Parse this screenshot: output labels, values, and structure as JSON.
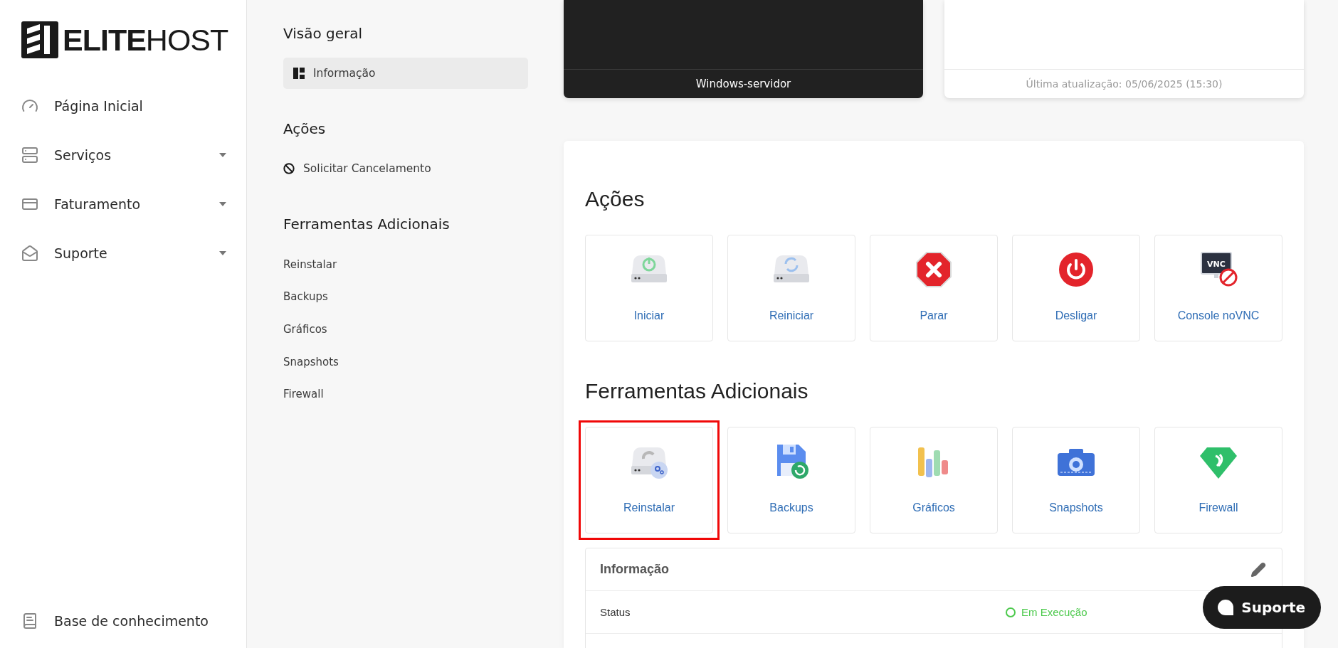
{
  "brand": {
    "bold": "ELITE",
    "light": "HOST"
  },
  "sidebar": {
    "items": [
      {
        "label": "Página Inicial",
        "expandable": false
      },
      {
        "label": "Serviços",
        "expandable": true
      },
      {
        "label": "Faturamento",
        "expandable": true
      },
      {
        "label": "Suporte",
        "expandable": true
      }
    ],
    "footer_item": {
      "label": "Base de conhecimento"
    }
  },
  "subnav": {
    "sections": [
      {
        "title": "Visão geral",
        "items": [
          {
            "label": "Informação",
            "selected": true,
            "kind": "icon"
          }
        ]
      },
      {
        "title": "Ações",
        "items": [
          {
            "label": "Solicitar Cancelamento",
            "selected": false,
            "kind": "icon"
          }
        ]
      },
      {
        "title": "Ferramentas Adicionais",
        "items": [
          {
            "label": "Reinstalar",
            "selected": false,
            "kind": "plain"
          },
          {
            "label": "Backups",
            "selected": false,
            "kind": "plain"
          },
          {
            "label": "Gráficos",
            "selected": false,
            "kind": "plain"
          },
          {
            "label": "Snapshots",
            "selected": false,
            "kind": "plain"
          },
          {
            "label": "Firewall",
            "selected": false,
            "kind": "plain"
          }
        ]
      }
    ]
  },
  "server_card": {
    "caption": "Windows-servidor"
  },
  "stats_card": {
    "footer": "Última atualização: 05/06/2025 (15:30)"
  },
  "actions": {
    "title": "Ações",
    "tiles": [
      {
        "label": "Iniciar",
        "kind": "start"
      },
      {
        "label": "Reiniciar",
        "kind": "restart"
      },
      {
        "label": "Parar",
        "kind": "stop"
      },
      {
        "label": "Desligar",
        "kind": "poweroff"
      },
      {
        "label": "Console noVNC",
        "kind": "vnc",
        "icon_text": "VNC"
      }
    ]
  },
  "tools": {
    "title": "Ferramentas Adicionais",
    "tiles": [
      {
        "label": "Reinstalar",
        "kind": "reinstall",
        "highlighted": true
      },
      {
        "label": "Backups",
        "kind": "backup",
        "highlighted": false
      },
      {
        "label": "Gráficos",
        "kind": "charts",
        "highlighted": false
      },
      {
        "label": "Snapshots",
        "kind": "snapshot",
        "highlighted": false
      },
      {
        "label": "Firewall",
        "kind": "firewall",
        "highlighted": false
      }
    ]
  },
  "info": {
    "title": "Informação",
    "rows": [
      {
        "label": "Status",
        "value": "Em Execução",
        "kind": "status"
      }
    ]
  },
  "support_button": {
    "label": "Suporte"
  }
}
